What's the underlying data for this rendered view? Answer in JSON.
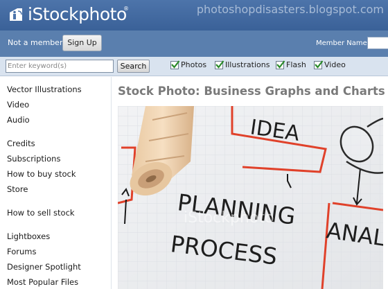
{
  "header": {
    "logo_text": "iStockphoto",
    "logo_reg": "®",
    "watermark": "photoshopdisasters.blogspot.com"
  },
  "memberbar": {
    "not_member": "Not a member?",
    "signup_label": "Sign Up",
    "member_name_label": "Member Name"
  },
  "searchbar": {
    "placeholder": "Enter keyword(s)",
    "search_label": "Search",
    "filters": [
      {
        "label": "Photos",
        "checked": true
      },
      {
        "label": "Illustrations",
        "checked": true
      },
      {
        "label": "Flash",
        "checked": true
      },
      {
        "label": "Video",
        "checked": true
      }
    ]
  },
  "sidebar": {
    "items": [
      "Vector Illustrations",
      "Video",
      "Audio",
      "Credits",
      "Subscriptions",
      "How to buy stock",
      "Store",
      "How to sell stock",
      "Lightboxes",
      "Forums",
      "Designer Spotlight",
      "Most Popular Files"
    ]
  },
  "main": {
    "title": "Stock Photo: Business Graphs and Charts",
    "photo": {
      "text_idea": "IDEA",
      "text_planning": "PLANNING",
      "text_process": "PROCESS",
      "text_anal": "ANAL",
      "watermark": "iStockphoto"
    }
  },
  "colors": {
    "header_blue": "#4d74aa",
    "memberbar_blue": "#5a7fae",
    "searchbar_bg": "#d9e3ef",
    "checkbox_check": "#2a8a2a",
    "diagram_red": "#e0412a"
  }
}
